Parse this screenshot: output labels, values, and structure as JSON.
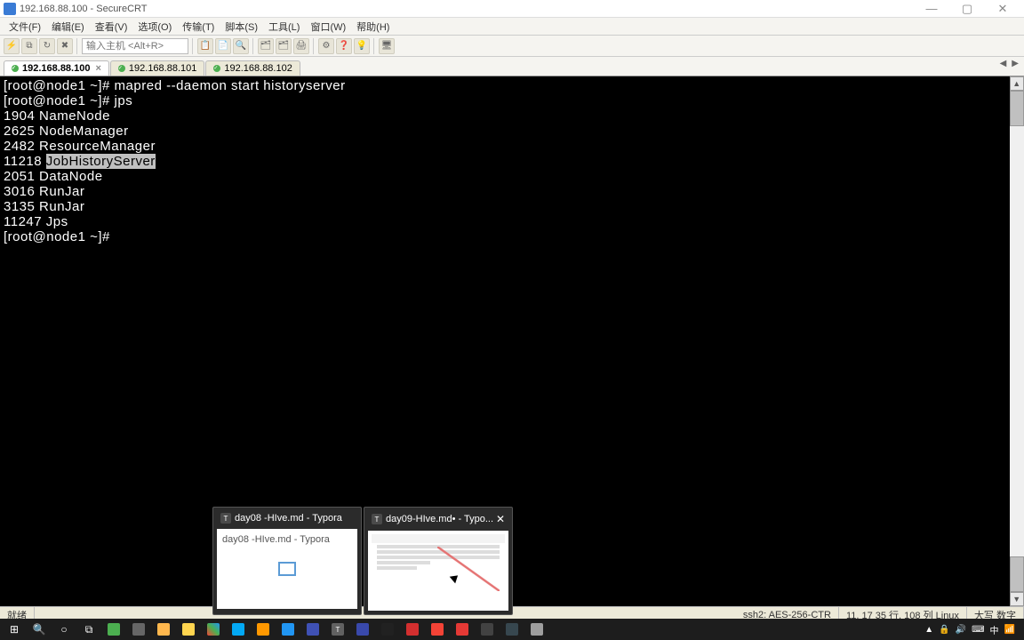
{
  "window": {
    "title": "192.168.88.100 - SecureCRT",
    "min": "—",
    "max": "▢",
    "close": "✕"
  },
  "menubar": [
    "文件(F)",
    "编辑(E)",
    "查看(V)",
    "选项(O)",
    "传输(T)",
    "脚本(S)",
    "工具(L)",
    "窗口(W)",
    "帮助(H)"
  ],
  "toolbar": {
    "host_placeholder": "输入主机 <Alt+R>"
  },
  "tabs": [
    {
      "label": "192.168.88.100",
      "active": true
    },
    {
      "label": "192.168.88.101",
      "active": false
    },
    {
      "label": "192.168.88.102",
      "active": false
    }
  ],
  "terminal": {
    "lines": [
      {
        "prompt": "[root@node1 ~]# ",
        "cmd": "mapred --daemon start historyserver"
      },
      {
        "prompt": "[root@node1 ~]# ",
        "cmd": "jps"
      },
      {
        "text": "1904 NameNode"
      },
      {
        "text": "2625 NodeManager"
      },
      {
        "text": "2482 ResourceManager"
      },
      {
        "text": "11218 ",
        "hl": "JobHistoryServer"
      },
      {
        "text": "2051 DataNode"
      },
      {
        "text": "3016 RunJar"
      },
      {
        "text": "3135 RunJar"
      },
      {
        "text": "11247 Jps"
      },
      {
        "prompt": "[root@node1 ~]# ",
        "cmd": ""
      }
    ]
  },
  "statusbar": {
    "ready": "就绪",
    "conn": "ssh2: AES-256-CTR",
    "pos": "11,  17   35 行, 108 列  Linux",
    "caps": "大写 数字"
  },
  "thumbnails": [
    {
      "title": "day08 -HIve.md - Typora",
      "body_title": "day08 -HIve.md - Typora",
      "close": ""
    },
    {
      "title": "day09-HIve.md• - Typo...",
      "body_title": "",
      "close": "✕"
    }
  ],
  "tray": {
    "items": [
      "▲",
      "🔒",
      "🔊",
      "⌨",
      "中",
      "📶"
    ],
    "time": ""
  }
}
